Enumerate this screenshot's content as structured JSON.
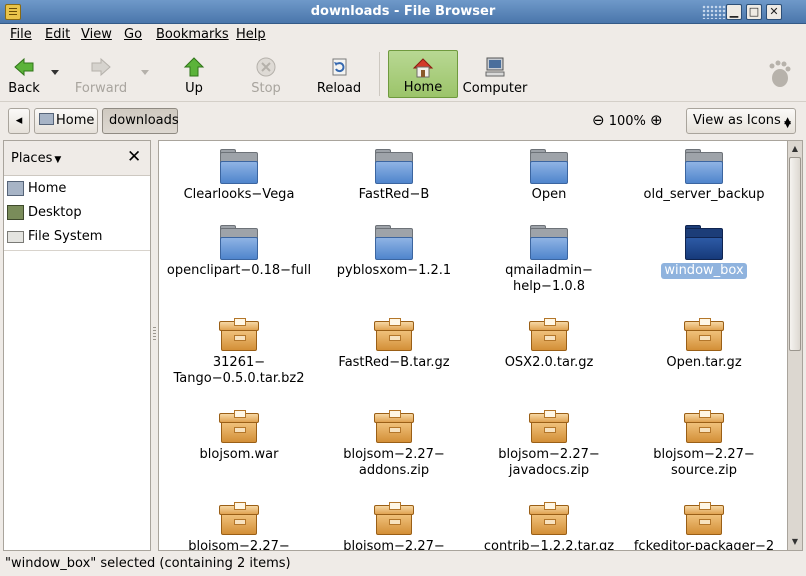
{
  "window": {
    "title": "downloads - File Browser"
  },
  "menu": [
    "File",
    "Edit",
    "View",
    "Go",
    "Bookmarks",
    "Help"
  ],
  "toolbar": {
    "back": "Back",
    "forward": "Forward",
    "up": "Up",
    "stop": "Stop",
    "reload": "Reload",
    "home": "Home",
    "computer": "Computer"
  },
  "location": {
    "crumbs": [
      "Home",
      "downloads"
    ],
    "zoom": "100%",
    "view_mode": "View as Icons"
  },
  "sidebar": {
    "header": "Places",
    "items": [
      "Home",
      "Desktop",
      "File System"
    ]
  },
  "files": [
    {
      "name": "Clearlooks−Vega",
      "kind": "folder"
    },
    {
      "name": "FastRed−B",
      "kind": "folder"
    },
    {
      "name": "Open",
      "kind": "folder"
    },
    {
      "name": "old_server_backup",
      "kind": "folder"
    },
    {
      "name": "openclipart−0.18−full",
      "kind": "folder"
    },
    {
      "name": "pyblosxom−1.2.1",
      "kind": "folder"
    },
    {
      "name": "qmailadmin−\nhelp−1.0.8",
      "kind": "folder"
    },
    {
      "name": "window_box",
      "kind": "folder",
      "selected": true
    },
    {
      "name": "31261−\nTango−0.5.0.tar.bz2",
      "kind": "archive"
    },
    {
      "name": "FastRed−B.tar.gz",
      "kind": "archive"
    },
    {
      "name": "OSX2.0.tar.gz",
      "kind": "archive"
    },
    {
      "name": "Open.tar.gz",
      "kind": "archive"
    },
    {
      "name": "blojsom.war",
      "kind": "archive"
    },
    {
      "name": "blojsom−2.27−\naddons.zip",
      "kind": "archive"
    },
    {
      "name": "blojsom−2.27−\njavadocs.zip",
      "kind": "archive"
    },
    {
      "name": "blojsom−2.27−\nsource.zip",
      "kind": "archive"
    },
    {
      "name": "blojsom−2.27−",
      "kind": "archive"
    },
    {
      "name": "blojsom−2.27−",
      "kind": "archive"
    },
    {
      "name": "contrib−1.2.2.tar.gz",
      "kind": "archive"
    },
    {
      "name": "fckeditor-packager−2",
      "kind": "archive"
    }
  ],
  "status": "\"window_box\" selected (containing 2 items)",
  "colors": {
    "title_bar": "#5a86bb",
    "selection": "#8fb3de",
    "home_active": "#a8cf7c"
  }
}
